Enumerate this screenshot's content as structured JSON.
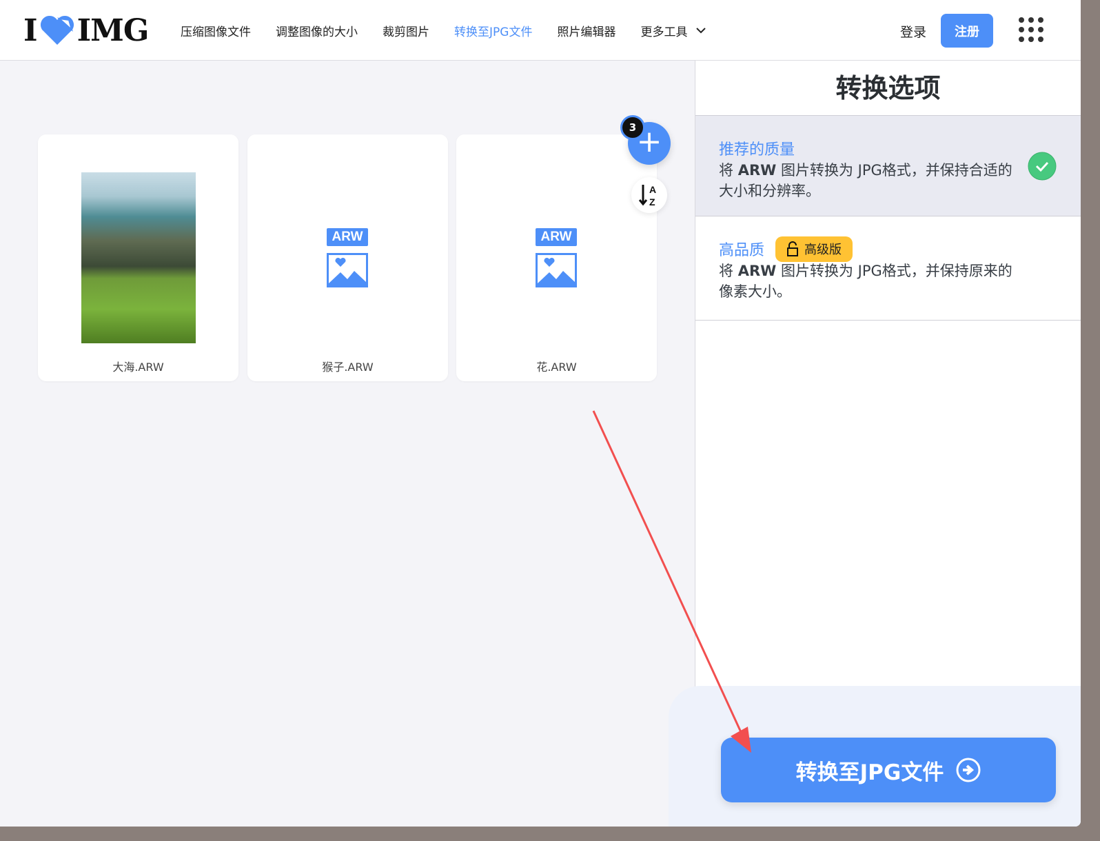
{
  "header": {
    "logo": "I ♥ IMG",
    "nav": [
      "压缩图像文件",
      "调整图像的大小",
      "裁剪图片",
      "转换至JPG文件",
      "照片编辑器",
      "更多工具"
    ],
    "active_nav": "转换至JPG文件",
    "login": "登录",
    "signup": "注册"
  },
  "files": [
    {
      "name": "大海.ARW",
      "thumbnail": "photo"
    },
    {
      "name": "猴子.ARW",
      "thumbnail": "ARW"
    },
    {
      "name": "花.ARW",
      "thumbnail": "ARW"
    }
  ],
  "file_count": "3",
  "sidebar": {
    "title": "转换选项",
    "options": [
      {
        "title": "推荐的质量",
        "desc_pre": "将 ",
        "desc_bold": "ARW",
        "desc_post": " 图片转换为 JPG格式，并保持合适的大小和分辨率。",
        "selected": true
      },
      {
        "title": "高品质",
        "badge": "高级版",
        "desc_pre": "将 ",
        "desc_bold": "ARW",
        "desc_post": " 图片转换为 JPG格式，并保持原来的像素大小。",
        "selected": false
      }
    ],
    "convert_button": "转换至JPG文件"
  },
  "colors": {
    "accent": "#4d8ff8",
    "premium": "#ffc233",
    "check": "#47c97f",
    "annotation": "#f24f4f"
  }
}
